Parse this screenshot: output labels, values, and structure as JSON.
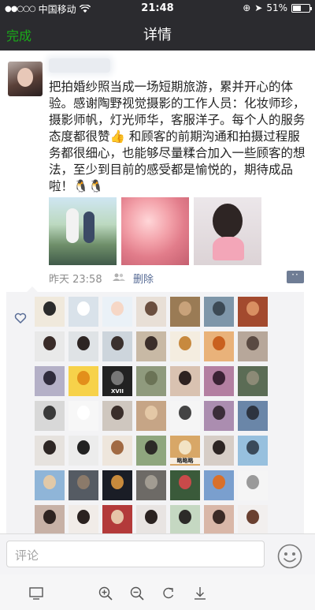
{
  "status_bar": {
    "carrier": "中国移动",
    "time": "21:48",
    "battery": "51%",
    "battery_level": 0.51
  },
  "nav": {
    "done_label": "完成",
    "title": "详情"
  },
  "post": {
    "text": "把拍婚纱照当成一场短期旅游，累并开心的体验。感谢陶野视觉摄影的工作人员：化妆师珍，摄影师帆，灯光师华，客服洋子。每个人的服务态度都很赞👍 和顾客的前期沟通和拍摄过程服务都很细心，也能够尽量糅合加入一些顾客的想法，至少到目前的感受都是愉悦的，期待成品啦！🐧🐧",
    "time": "昨天 23:58",
    "delete_label": "删除",
    "photos": [
      "photo-couple-bicycle",
      "photo-pink-flowers",
      "photo-woman-with-flowers"
    ]
  },
  "likes": {
    "icon": "heart-outline-icon",
    "avatars": [
      {
        "bg": "#f0e9dc",
        "face": "#2b2b2b",
        "tag": ""
      },
      {
        "bg": "#d9e2ea",
        "face": "#ffffff",
        "tag": ""
      },
      {
        "bg": "#eaf1f7",
        "face": "#f6d7c6",
        "tag": ""
      },
      {
        "bg": "#e8dfd6",
        "face": "#6b4f3f",
        "tag": ""
      },
      {
        "bg": "#9a7b55",
        "face": "#c8a27a",
        "tag": ""
      },
      {
        "bg": "#7e96a9",
        "face": "#3c4a55",
        "tag": ""
      },
      {
        "bg": "#a34a2e",
        "face": "#d98f62",
        "tag": ""
      },
      {
        "bg": "#e9e9e9",
        "face": "#3a2c29",
        "tag": ""
      },
      {
        "bg": "#dfe3e6",
        "face": "#2d2523",
        "tag": ""
      },
      {
        "bg": "#cdd5dc",
        "face": "#3a302d",
        "tag": ""
      },
      {
        "bg": "#c8b9a5",
        "face": "#3b2e2a",
        "tag": ""
      },
      {
        "bg": "#f4ede0",
        "face": "#c7893e",
        "tag": ""
      },
      {
        "bg": "#e9b27a",
        "face": "#c9601e",
        "tag": ""
      },
      {
        "bg": "#b7a79a",
        "face": "#5a4a42",
        "tag": ""
      },
      {
        "bg": "#b4b0c7",
        "face": "#2f2b3c",
        "tag": ""
      },
      {
        "bg": "#f7d24a",
        "face": "#e38f1b",
        "tag": ""
      },
      {
        "bg": "#222222",
        "face": "#777777",
        "tag": "XVII"
      },
      {
        "bg": "#8f9a7d",
        "face": "#6b7356",
        "tag": ""
      },
      {
        "bg": "#d9c2b1",
        "face": "#2e2220",
        "tag": ""
      },
      {
        "bg": "#b37fa1",
        "face": "#3b2234",
        "tag": ""
      },
      {
        "bg": "#5b6c55",
        "face": "#8c8a76",
        "tag": ""
      },
      {
        "bg": "#d8d8d8",
        "face": "#3a3a3a",
        "tag": ""
      },
      {
        "bg": "#f7f7f7",
        "face": "#ffffff",
        "tag": ""
      },
      {
        "bg": "#cfc7bf",
        "face": "#3a2e2a",
        "tag": ""
      },
      {
        "bg": "#c6a586",
        "face": "#e4c8a6",
        "tag": ""
      },
      {
        "bg": "#f5f5f5",
        "face": "#444444",
        "tag": ""
      },
      {
        "bg": "#ab8db0",
        "face": "#3b2d39",
        "tag": ""
      },
      {
        "bg": "#6a86a8",
        "face": "#2d3440",
        "tag": ""
      },
      {
        "bg": "#e6e2de",
        "face": "#2e2624",
        "tag": ""
      },
      {
        "bg": "#ececec",
        "face": "#222222",
        "tag": ""
      },
      {
        "bg": "#eee6dc",
        "face": "#a16a43",
        "tag": ""
      },
      {
        "bg": "#8fa67e",
        "face": "#2c2a26",
        "tag": ""
      },
      {
        "bg": "#d8a767",
        "face": "#f2e3c4",
        "tag": "略略略"
      },
      {
        "bg": "#d6cdc6",
        "face": "#2c2422",
        "tag": ""
      },
      {
        "bg": "#97c0de",
        "face": "#3a4a5a",
        "tag": ""
      },
      {
        "bg": "#8fb5d8",
        "face": "#e1c9a8",
        "tag": ""
      },
      {
        "bg": "#555b63",
        "face": "#8b7a6a",
        "tag": ""
      },
      {
        "bg": "#1a1d26",
        "face": "#c88a3c",
        "tag": ""
      },
      {
        "bg": "#6d6a66",
        "face": "#a29c92",
        "tag": ""
      },
      {
        "bg": "#3a5a3a",
        "face": "#c94a4a",
        "tag": ""
      },
      {
        "bg": "#7a9fce",
        "face": "#d9702a",
        "tag": ""
      },
      {
        "bg": "#f5f5f5",
        "face": "#9a9a9a",
        "tag": ""
      },
      {
        "bg": "#c7b1a6",
        "face": "#2e2321",
        "tag": ""
      },
      {
        "bg": "#f1ece8",
        "face": "#2b2220",
        "tag": ""
      },
      {
        "bg": "#b33a3a",
        "face": "#e6c4a8",
        "tag": ""
      },
      {
        "bg": "#e8e4e2",
        "face": "#2a2220",
        "tag": ""
      },
      {
        "bg": "#c5d8c2",
        "face": "#2c2a28",
        "tag": ""
      },
      {
        "bg": "#d9b7a8",
        "face": "#3b2a25",
        "tag": ""
      },
      {
        "bg": "#f2efee",
        "face": "#6a4030",
        "tag": ""
      }
    ]
  },
  "comment": {
    "placeholder": "评论",
    "emoji_icon": "smiley-icon"
  },
  "toolbar": {
    "icons": [
      "screen-icon",
      "zoom-in-icon",
      "zoom-out-icon",
      "rotate-icon",
      "download-icon"
    ]
  }
}
